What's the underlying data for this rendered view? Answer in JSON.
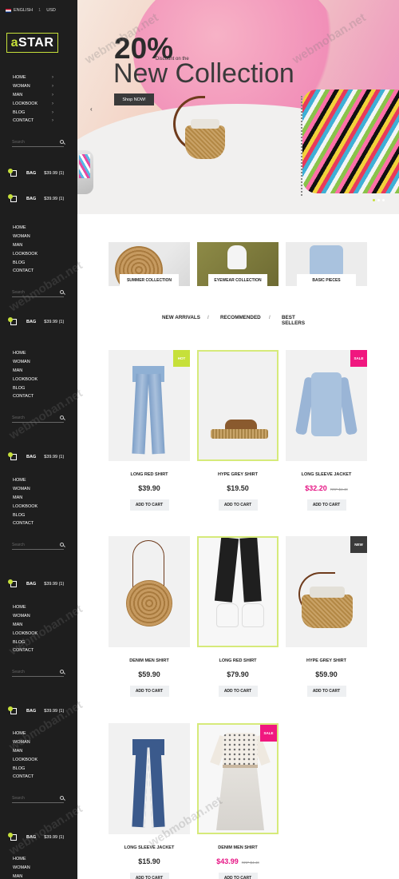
{
  "topbar": {
    "language": "ENGLISH",
    "quantity": "1",
    "currency": "USD"
  },
  "logo": {
    "prefix": "a",
    "rest": "STAR"
  },
  "nav": [
    {
      "label": "HOME"
    },
    {
      "label": "WOMAN"
    },
    {
      "label": "MAN"
    },
    {
      "label": "LOOKBOOK"
    },
    {
      "label": "BLOG"
    },
    {
      "label": "CONTACT"
    }
  ],
  "search": {
    "placeholder": "Search"
  },
  "bag": {
    "label": "BAG",
    "total": "$39.99 (1)"
  },
  "hero": {
    "percent": "20%",
    "discount": "Discount on the",
    "title": "New Collection",
    "button": "Shop NOW!",
    "prev": "‹"
  },
  "categories": [
    {
      "label": "SUMMER COLLECTION"
    },
    {
      "label": "EYEWEAR COLLECTION"
    },
    {
      "label": "BASIC PIECES"
    }
  ],
  "tabs": [
    "NEW ARRIVALS",
    "RECOMMENDED",
    "BEST SELLERS"
  ],
  "products": [
    {
      "name": "LONG RED SHIRT",
      "price": "$39.90",
      "badge": "HOT",
      "cta": "ADD TO CART"
    },
    {
      "name": "HYPE GREY SHIRT",
      "price": "$19.50",
      "cta": "ADD TO CART"
    },
    {
      "name": "LONG SLEEVE JACKET",
      "price": "$32.20",
      "old_price": "RRP $4.40",
      "badge": "SALE",
      "cta": "ADD TO CART"
    },
    {
      "name": "DENIM MEN SHIRT",
      "price": "$59.90",
      "cta": "ADD TO CART"
    },
    {
      "name": "LONG RED SHIRT",
      "price": "$79.90",
      "cta": "ADD TO CART"
    },
    {
      "name": "HYPE GREY SHIRT",
      "price": "$59.90",
      "badge": "NEW",
      "cta": "ADD TO CART"
    },
    {
      "name": "LONG SLEEVE JACKET",
      "price": "$15.90",
      "cta": "ADD TO CART"
    },
    {
      "name": "DENIM MEN SHIRT",
      "price": "$43.99",
      "old_price": "RRP $4.40",
      "badge": "SALE",
      "cta": "ADD TO CART"
    }
  ],
  "watermark": "webmoban.net",
  "colors": {
    "accent": "#c6e03a",
    "sale": "#f0177f",
    "sidebar": "#1e1e1e"
  }
}
